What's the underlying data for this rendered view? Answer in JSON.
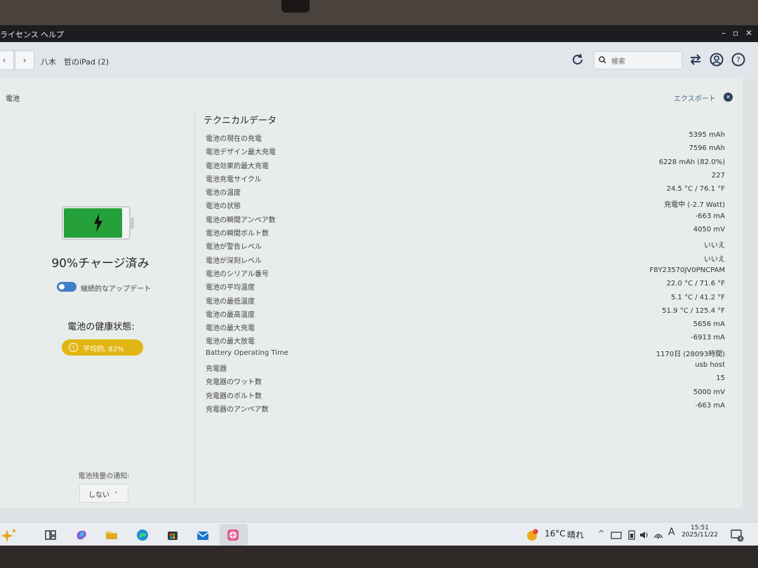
{
  "menu": {
    "license": "ライセンス",
    "help": "ヘルプ"
  },
  "window_controls": {
    "minimize": "–",
    "maximize": "▫",
    "close": "✕"
  },
  "toolbar": {
    "back": "‹",
    "forward": "›",
    "device_name": "八木　哲のiPad (2)",
    "search_placeholder": "検索"
  },
  "panel": {
    "section_title": "電池",
    "export_label": "エクスポート",
    "close_label": "✕"
  },
  "battery": {
    "level_percent": 90,
    "charge_text": "90%チャージ済み",
    "continuous_update_label": "継続的なアップデート",
    "continuous_update_on": true,
    "health_label": "電池の健康状態:",
    "health_badge": "平均的, 82%",
    "notify_label": "電池残量の通知:",
    "notify_value": "しない",
    "colors": {
      "fill": "#26a13a",
      "badge": "#e1b612",
      "toggle": "#3d7ec9"
    }
  },
  "technical": {
    "title": "テクニカルデータ",
    "rows": [
      {
        "k": "電池の現在の充電",
        "v": "5395 mAh"
      },
      {
        "k": "電池デザイン最大充電",
        "v": "7596 mAh"
      },
      {
        "k": "電池効果的最大充電",
        "v": "6228 mAh (82.0%)"
      },
      {
        "k": "電池充電サイクル",
        "v": "227"
      },
      {
        "k": "電池の温度",
        "v": "24.5 °C / 76.1 °F"
      },
      {
        "k": "電池の状態",
        "v": "充電中 (-2.7 Watt)"
      },
      {
        "k": "電池の瞬間アンペア数",
        "v": "-663 mA"
      },
      {
        "k": "電池の瞬間ボルト数",
        "v": "4050 mV"
      },
      {
        "k": "電池が警告レベル",
        "v": "いいえ"
      },
      {
        "k": "電池が深刻レベル",
        "v": "いいえ"
      },
      {
        "k": "電池のシリアル番号",
        "v": "F8Y23570JV0PNCPAM"
      },
      {
        "k": "電池の平均温度",
        "v": "22.0 °C / 71.6 °F"
      },
      {
        "k": "電池の最低温度",
        "v": "5.1 °C / 41.2 °F"
      },
      {
        "k": "電池の最高温度",
        "v": "51.9 °C / 125.4 °F"
      },
      {
        "k": "電池の最大充電",
        "v": "5656 mA"
      },
      {
        "k": "電池の最大放電",
        "v": "-6913 mA"
      },
      {
        "k": "Battery Operating Time",
        "v": "1170日 (28093時間)"
      },
      {
        "k": "充電器",
        "v": "usb host"
      },
      {
        "k": "充電器のワット数",
        "v": "15"
      },
      {
        "k": "充電器のボルト数",
        "v": "5000 mV"
      },
      {
        "k": "充電器のアンペア数",
        "v": "-663 mA"
      }
    ]
  },
  "taskbar": {
    "weather_temp": "16°C",
    "weather_text": "晴れ",
    "ime": "A",
    "time": "15:51",
    "date": "2025/11/22",
    "notification_count": "4",
    "apps": [
      "widgets-icon",
      "copilot-icon",
      "file-explorer-icon",
      "edge-icon",
      "store-icon",
      "mail-icon",
      "imazing-icon"
    ]
  }
}
